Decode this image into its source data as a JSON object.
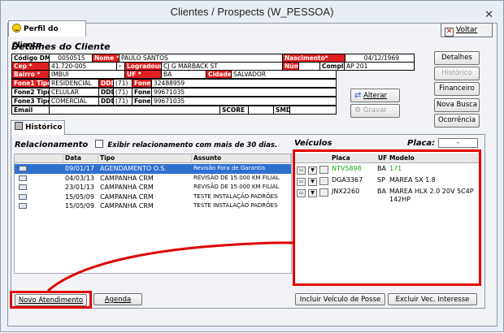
{
  "window": {
    "title": "Clientes / Prospects (W_PESSOA)",
    "close_glyph": "✕"
  },
  "tab_perfil": "Perfil do Cliente",
  "voltar_label": "Voltar",
  "detalhes_title": "Detalhes do Cliente",
  "fields": {
    "codigo_label": "Código DMS",
    "codigo": "0050515",
    "nome_label": "Nome *",
    "nome": "PAULO SANTOS",
    "nascimento_label": "Nascimento*",
    "nascimento": "04/12/1969",
    "cep_label": "Cep *",
    "cep": "41.720-005",
    "logradouro_label": "Logradouro*",
    "logradouro": "CJ G MARBACK ST",
    "num_label": "Núm*",
    "num": "",
    "compl_label": "Compl.",
    "compl": "AP 201",
    "bairro_label": "Bairro *",
    "bairro": "IMBUI",
    "uf_label": "UF *",
    "uf": "BA",
    "cidade_label": "Cidade *",
    "cidade": "SALVADOR",
    "fone1tipo_label": "Fone1 Tipo*",
    "fone1tipo": "RESIDENCIAL",
    "ddd_label": "DDD",
    "ddd1": "(71)",
    "fone1_label": "Fone1",
    "fone1": "32488959",
    "fone2tipo_label": "Fone2 Tipo",
    "fone2tipo": "CELULAR",
    "ddd2": "(71)",
    "fone2_label": "Fone2",
    "fone2": "99671035",
    "fone3tipo_label": "Fone3 Tipo",
    "fone3tipo": "COMERCIAL",
    "ddd3": "(71)",
    "fone3_label": "Fone3",
    "fone3": "99671035",
    "email_label": "Email",
    "email": "",
    "score_label": "SCORE",
    "score": "",
    "smd_label": "SMD",
    "smd": ""
  },
  "buttons": {
    "detalhes": "Detalhes",
    "historico": "Histórico",
    "financeiro": "Financeiro",
    "nova_busca": "Nova Busca",
    "ocorrencia": "Ocorrência",
    "alterar": "Alterar",
    "gravar": "Gravar"
  },
  "tab_historico": "Histórico",
  "relacionamento": {
    "title": "Relacionamento",
    "checkbox_label": "Exibir relacionamento com mais de 30 dias.",
    "columns": [
      "Data",
      "Tipo",
      "Assunto"
    ],
    "rows": [
      {
        "data": "09/01/17",
        "tipo": "AGENDAMENTO O.S.",
        "assunto": "Revisão Fora de Garantia",
        "selected": true
      },
      {
        "data": "04/03/13",
        "tipo": "CAMPANHA CRM",
        "assunto": "REVISÃO DE 15.000 KM FILIAL",
        "selected": false
      },
      {
        "data": "23/01/13",
        "tipo": "CAMPANHA CRM",
        "assunto": "REVISÃO DE 15.000 KM FILIAL",
        "selected": false
      },
      {
        "data": "15/05/09",
        "tipo": "CAMPANHA CRM",
        "assunto": "TESTE INSTALAÇÃO PADRÕES",
        "selected": false
      },
      {
        "data": "15/05/09",
        "tipo": "CAMPANHA CRM",
        "assunto": "TESTE INSTALAÇÃO PADRÕES",
        "selected": false
      }
    ]
  },
  "veiculos": {
    "title": "Veículos",
    "placa_label": "Placa:",
    "placa_value": "-",
    "columns": [
      "Placa",
      "UF",
      "Modelo"
    ],
    "rows": [
      {
        "placa": "NTV5898",
        "uf": "BA",
        "modelo": "171",
        "highlight": true
      },
      {
        "placa": "DGA3367",
        "uf": "SP",
        "modelo": "MAREA SX 1.8",
        "highlight": false
      },
      {
        "placa": "JNX2260",
        "uf": "BA",
        "modelo": "MAREA HLX 2.0 20V 5C4P",
        "modelo2": "142HP",
        "highlight": false
      }
    ]
  },
  "bottom_buttons": {
    "novo_atendimento": "Novo Atendimento",
    "agenda": "Agenda",
    "incluir_veiculo": "Incluir Veículo de Posse",
    "excluir_vec": "Excluir Vec. Interesse"
  },
  "colors": {
    "required_label": "#e02020",
    "selected_row": "#2f6fd0",
    "highlight_text": "#18a818",
    "annotation": "#e00000"
  }
}
